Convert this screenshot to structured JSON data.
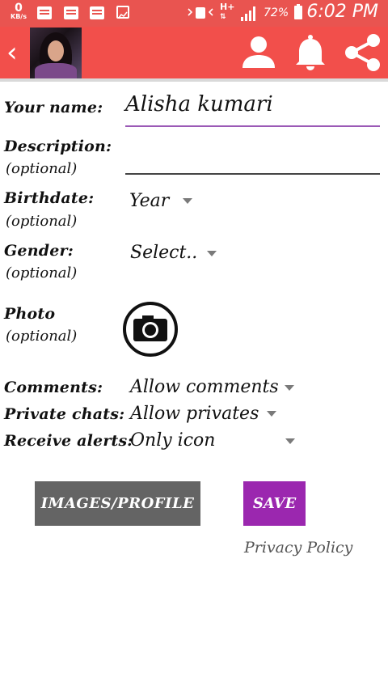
{
  "status_bar": {
    "net_speed_value": "0",
    "net_speed_unit": "KB/s",
    "network_type": "H+",
    "battery": "72%",
    "time": "6:02 PM",
    "notification_icons": [
      "message-icon",
      "message-icon",
      "message-icon",
      "image-icon"
    ]
  },
  "app_bar": {
    "back_icon": "chevron-left-icon",
    "action_icons": [
      "person-icon",
      "bell-icon",
      "share-icon"
    ],
    "color": "#f24f4b"
  },
  "form": {
    "name_label": "Your name:",
    "name_value": "Alisha kumari",
    "description_label": "Description:",
    "description_hint": "(optional)",
    "description_value": "",
    "birthdate_label": "Birthdate:",
    "birthdate_hint": "(optional)",
    "birthdate_value": "Year",
    "gender_label": "Gender:",
    "gender_hint": "(optional)",
    "gender_value": "Select..",
    "photo_label": "Photo",
    "photo_hint": "(optional)",
    "photo_icon": "camera-icon",
    "comments_label": "Comments:",
    "comments_value": "Allow comments",
    "private_chats_label": "Private chats:",
    "private_chats_value": "Allow privates",
    "alerts_label": "Receive alerts:",
    "alerts_value": "Only icon"
  },
  "buttons": {
    "images_profile": "IMAGES/PROFILE",
    "save": "SAVE"
  },
  "links": {
    "privacy_policy": "Privacy Policy"
  },
  "colors": {
    "accent_red": "#f24f4b",
    "save_purple": "#9b27af",
    "images_gray": "#646464",
    "name_underline": "#9b59b6"
  }
}
